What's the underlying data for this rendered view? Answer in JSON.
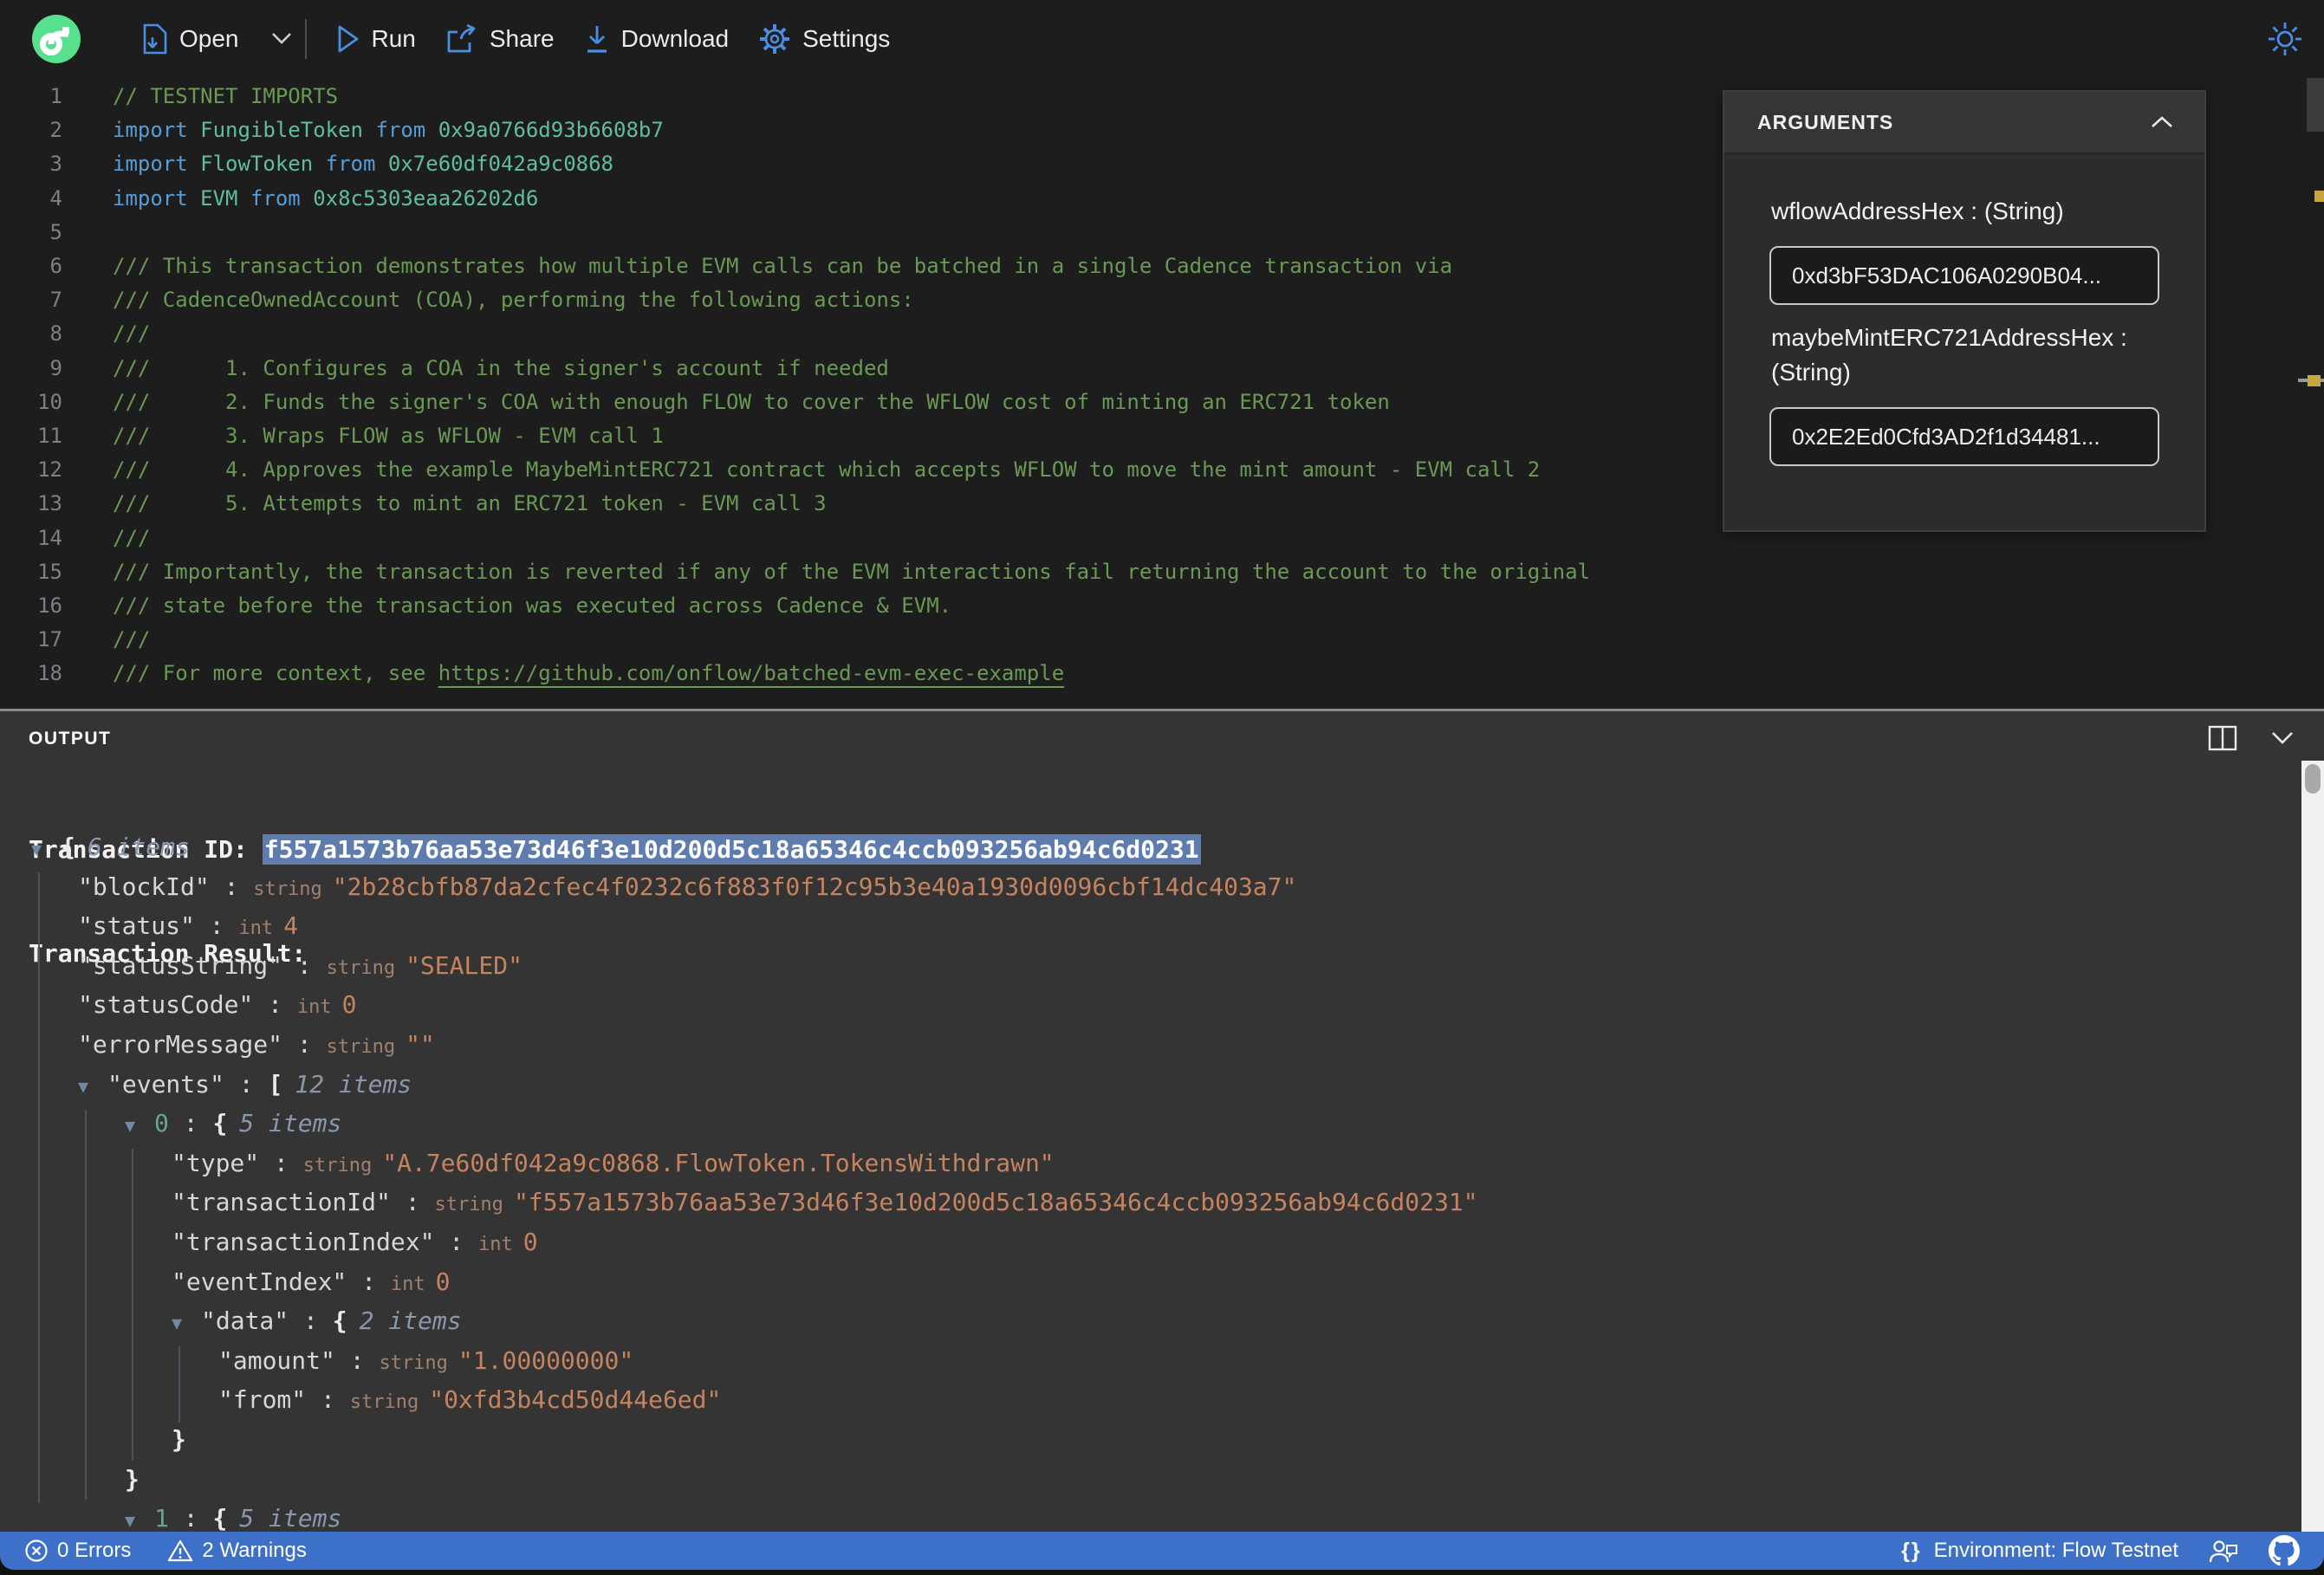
{
  "toolbar": {
    "open": "Open",
    "run": "Run",
    "share": "Share",
    "download": "Download",
    "settings": "Settings"
  },
  "editor": {
    "lines": [
      {
        "n": 1,
        "segs": [
          [
            "comment",
            "// TESTNET IMPORTS"
          ]
        ]
      },
      {
        "n": 2,
        "segs": [
          [
            "kw",
            "import "
          ],
          [
            "ty",
            "FungibleToken "
          ],
          [
            "kw",
            "from "
          ],
          [
            "ty",
            "0x9a0766d93b6608b7"
          ]
        ]
      },
      {
        "n": 3,
        "segs": [
          [
            "kw",
            "import "
          ],
          [
            "ty",
            "FlowToken "
          ],
          [
            "kw",
            "from "
          ],
          [
            "ty",
            "0x7e60df042a9c0868"
          ]
        ]
      },
      {
        "n": 4,
        "segs": [
          [
            "kw",
            "import "
          ],
          [
            "ty",
            "EVM "
          ],
          [
            "kw",
            "from "
          ],
          [
            "ty",
            "0x8c5303eaa26202d6"
          ]
        ]
      },
      {
        "n": 5,
        "segs": []
      },
      {
        "n": 6,
        "segs": [
          [
            "comment",
            "/// This transaction demonstrates how multiple EVM calls can be batched in a single Cadence transaction via"
          ]
        ]
      },
      {
        "n": 7,
        "segs": [
          [
            "comment",
            "/// CadenceOwnedAccount (COA), performing the following actions:"
          ]
        ]
      },
      {
        "n": 8,
        "segs": [
          [
            "comment",
            "///"
          ]
        ]
      },
      {
        "n": 9,
        "segs": [
          [
            "comment",
            "///      1. Configures a COA in the signer's account if needed"
          ]
        ]
      },
      {
        "n": 10,
        "segs": [
          [
            "comment",
            "///      2. Funds the signer's COA with enough FLOW to cover the WFLOW cost of minting an ERC721 token"
          ]
        ]
      },
      {
        "n": 11,
        "segs": [
          [
            "comment",
            "///      3. Wraps FLOW as WFLOW - EVM call 1"
          ]
        ]
      },
      {
        "n": 12,
        "segs": [
          [
            "comment",
            "///      4. Approves the example MaybeMintERC721 contract which accepts WFLOW to move the mint amount - EVM call 2"
          ]
        ]
      },
      {
        "n": 13,
        "segs": [
          [
            "comment",
            "///      5. Attempts to mint an ERC721 token - EVM call 3"
          ]
        ]
      },
      {
        "n": 14,
        "segs": [
          [
            "comment",
            "///"
          ]
        ]
      },
      {
        "n": 15,
        "segs": [
          [
            "comment",
            "/// Importantly, the transaction is reverted if any of the EVM interactions fail returning the account to the original"
          ]
        ]
      },
      {
        "n": 16,
        "segs": [
          [
            "comment",
            "/// state before the transaction was executed across Cadence & EVM."
          ]
        ]
      },
      {
        "n": 17,
        "segs": [
          [
            "comment",
            "///"
          ]
        ]
      },
      {
        "n": 18,
        "segs": [
          [
            "comment",
            "/// For more context, see "
          ],
          [
            "link",
            "https://github.com/onflow/batched-evm-exec-example"
          ]
        ]
      }
    ]
  },
  "arguments_panel": {
    "title": "ARGUMENTS",
    "fields": [
      {
        "label": "wflowAddressHex : (String)",
        "value": "0xd3bF53DAC106A0290B04..."
      },
      {
        "label": "maybeMintERC721AddressHex : (String)",
        "value": "0x2E2Ed0Cfd3AD2f1d34481..."
      }
    ]
  },
  "output": {
    "title": "OUTPUT",
    "transaction_id_label": "Transaction ID: ",
    "transaction_id": "f557a1573b76aa53e73d46f3e10d200d5c18a65346c4ccb093256ab94c6d0231",
    "transaction_result_label": "Transaction Result:",
    "tree": [
      {
        "i": 0,
        "s": [
          [
            "arrow",
            ""
          ],
          [
            "br",
            "{"
          ],
          [
            "it",
            "6 items"
          ]
        ]
      },
      {
        "i": 1,
        "s": [
          [
            "key",
            "\"blockId\""
          ],
          [
            "pn",
            " : "
          ],
          [
            "ty",
            "string"
          ],
          [
            "str",
            "\"2b28cbfb87da2cfec4f0232c6f883f0f12c95b3e40a1930d0096cbf14dc403a7\""
          ]
        ]
      },
      {
        "i": 1,
        "s": [
          [
            "key",
            "\"status\""
          ],
          [
            "pn",
            " : "
          ],
          [
            "ty",
            "int"
          ],
          [
            "int",
            "4"
          ]
        ]
      },
      {
        "i": 1,
        "s": [
          [
            "key",
            "\"statusString\""
          ],
          [
            "pn",
            " : "
          ],
          [
            "ty",
            "string"
          ],
          [
            "str",
            "\"SEALED\""
          ]
        ]
      },
      {
        "i": 1,
        "s": [
          [
            "key",
            "\"statusCode\""
          ],
          [
            "pn",
            " : "
          ],
          [
            "ty",
            "int"
          ],
          [
            "int",
            "0"
          ]
        ]
      },
      {
        "i": 1,
        "s": [
          [
            "key",
            "\"errorMessage\""
          ],
          [
            "pn",
            " : "
          ],
          [
            "ty",
            "string"
          ],
          [
            "str",
            "\"\""
          ]
        ]
      },
      {
        "i": 1,
        "s": [
          [
            "arrow",
            ""
          ],
          [
            "key",
            "\"events\""
          ],
          [
            "pn",
            " : "
          ],
          [
            "br",
            "["
          ],
          [
            "it",
            "12 items"
          ]
        ]
      },
      {
        "i": 2,
        "s": [
          [
            "arrow",
            ""
          ],
          [
            "idx",
            "0"
          ],
          [
            "pn",
            " : "
          ],
          [
            "br",
            "{"
          ],
          [
            "it",
            "5 items"
          ]
        ]
      },
      {
        "i": 3,
        "s": [
          [
            "key",
            "\"type\""
          ],
          [
            "pn",
            " : "
          ],
          [
            "ty",
            "string"
          ],
          [
            "str",
            "\"A.7e60df042a9c0868.FlowToken.TokensWithdrawn\""
          ]
        ]
      },
      {
        "i": 3,
        "s": [
          [
            "key",
            "\"transactionId\""
          ],
          [
            "pn",
            " : "
          ],
          [
            "ty",
            "string"
          ],
          [
            "str",
            "\"f557a1573b76aa53e73d46f3e10d200d5c18a65346c4ccb093256ab94c6d0231\""
          ]
        ]
      },
      {
        "i": 3,
        "s": [
          [
            "key",
            "\"transactionIndex\""
          ],
          [
            "pn",
            " : "
          ],
          [
            "ty",
            "int"
          ],
          [
            "int",
            "0"
          ]
        ]
      },
      {
        "i": 3,
        "s": [
          [
            "key",
            "\"eventIndex\""
          ],
          [
            "pn",
            " : "
          ],
          [
            "ty",
            "int"
          ],
          [
            "int",
            "0"
          ]
        ]
      },
      {
        "i": 3,
        "s": [
          [
            "arrow",
            ""
          ],
          [
            "key",
            "\"data\""
          ],
          [
            "pn",
            " : "
          ],
          [
            "br",
            "{"
          ],
          [
            "it",
            "2 items"
          ]
        ]
      },
      {
        "i": 4,
        "s": [
          [
            "key",
            "\"amount\""
          ],
          [
            "pn",
            " : "
          ],
          [
            "ty",
            "string"
          ],
          [
            "str",
            "\"1.00000000\""
          ]
        ]
      },
      {
        "i": 4,
        "s": [
          [
            "key",
            "\"from\""
          ],
          [
            "pn",
            " : "
          ],
          [
            "ty",
            "string"
          ],
          [
            "str",
            "\"0xfd3b4cd50d44e6ed\""
          ]
        ]
      },
      {
        "i": 3,
        "s": [
          [
            "br",
            "}"
          ]
        ]
      },
      {
        "i": 2,
        "s": [
          [
            "br",
            "}"
          ]
        ]
      },
      {
        "i": 2,
        "s": [
          [
            "arrow",
            ""
          ],
          [
            "idx",
            "1"
          ],
          [
            "pn",
            " : "
          ],
          [
            "br",
            "{"
          ],
          [
            "it",
            "5 items"
          ]
        ]
      }
    ]
  },
  "status_bar": {
    "errors": "0 Errors",
    "warnings": "2 Warnings",
    "braces": "{}",
    "environment": "Environment: Flow Testnet"
  },
  "colors": {
    "accent_blue": "#4a8de2",
    "flow_green": "#57e08d",
    "editor_bg": "#1d1d1d",
    "output_bg": "#343434",
    "status_bar": "#3d70c9",
    "selection": "#5e7cae",
    "comment_green": "#6a9955",
    "keyword_blue": "#569cd6",
    "type_teal": "#5fbda2",
    "json_value": "#c5835f",
    "warning_marker": "#c9a63d"
  }
}
